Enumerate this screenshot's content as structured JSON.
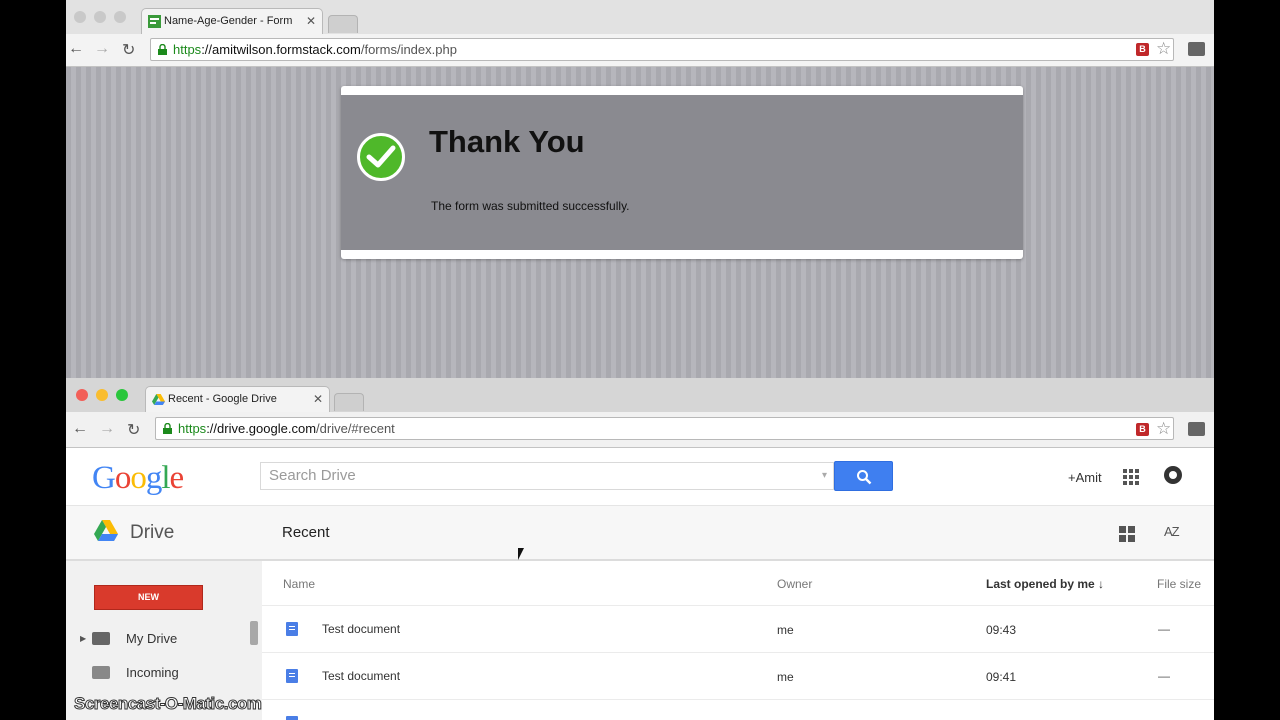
{
  "window1": {
    "tab_title": "Name-Age-Gender - Form",
    "url_scheme": "https",
    "url_host": "://amitwilson.formstack.com",
    "url_path": "/forms/index.php",
    "page": {
      "heading": "Thank You",
      "message": "The form was submitted successfully."
    }
  },
  "window2": {
    "tab_title": "Recent - Google Drive",
    "url_scheme": "https",
    "url_host": "://drive.google.com",
    "url_path": "/drive/#recent",
    "header": {
      "logo_text": "Google",
      "search_placeholder": "Search Drive",
      "user_label": "+Amit"
    },
    "drive_bar": {
      "app_label": "Drive",
      "section_title": "Recent",
      "sort_label": "AZ"
    },
    "sidebar": {
      "new_label": "NEW",
      "items": [
        {
          "label": "My Drive"
        },
        {
          "label": "Incoming"
        }
      ]
    },
    "file_list": {
      "columns": {
        "name": "Name",
        "owner": "Owner",
        "last_opened": "Last opened by me ↓",
        "file_size": "File size"
      },
      "rows": [
        {
          "name": "Test document",
          "owner": "me",
          "last_opened": "09:43",
          "file_size": "—"
        },
        {
          "name": "Test document",
          "owner": "me",
          "last_opened": "09:41",
          "file_size": "—"
        }
      ]
    }
  },
  "overlay": {
    "watermark": "Screencast-O-Matic.com"
  },
  "colors": {
    "url_secure_green": "#1c8a1c",
    "check_green": "#4fb82a",
    "new_button_red": "#d93a2c",
    "search_button_blue": "#3f7ff0",
    "google_blue": "#4285f4",
    "google_red": "#ea4335",
    "google_yellow": "#fbbc05",
    "google_green": "#34a853"
  },
  "icons": [
    "formstack-favicon",
    "drive-favicon",
    "lock-icon",
    "back-icon",
    "forward-icon",
    "reload-icon",
    "star-icon",
    "extension-icon",
    "menu-icon",
    "check-icon",
    "search-icon",
    "apps-grid-icon",
    "notifications-icon",
    "grid-view-icon",
    "folder-icon",
    "doc-icon"
  ]
}
